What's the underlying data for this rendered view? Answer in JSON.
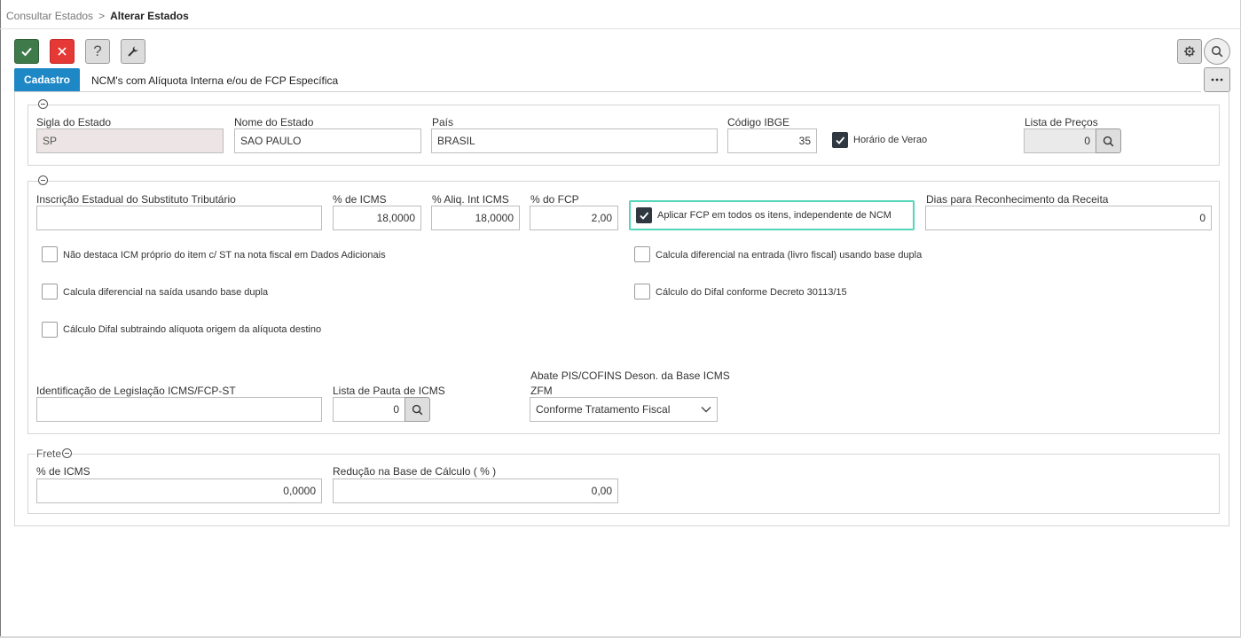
{
  "breadcrumb": {
    "parent": "Consultar Estados",
    "separator": ">",
    "current": "Alterar Estados"
  },
  "toolbar": {
    "help_label": "?"
  },
  "tabs": [
    {
      "label": "Cadastro",
      "active": true
    },
    {
      "label": "NCM's com Alíquota Interna e/ou de FCP Específica",
      "active": false
    }
  ],
  "section1": {
    "sigla": {
      "label": "Sigla do Estado",
      "value": "SP"
    },
    "nome": {
      "label": "Nome do Estado",
      "value": "SAO PAULO"
    },
    "pais": {
      "label": "País",
      "value": "BRASIL"
    },
    "ibge": {
      "label": "Código IBGE",
      "value": "35"
    },
    "horario_verao": {
      "label": "Horário de Verao",
      "checked": true
    },
    "lista_precos": {
      "label": "Lista de Preços",
      "value": "0"
    }
  },
  "section2": {
    "inscricao": {
      "label": "Inscrição Estadual do Substituto Tributário",
      "value": ""
    },
    "icms": {
      "label": "% de ICMS",
      "value": "18,0000"
    },
    "aliq_int": {
      "label": "% Aliq. Int ICMS",
      "value": "18,0000"
    },
    "fcp": {
      "label": "% do FCP",
      "value": "2,00"
    },
    "aplicar_fcp": {
      "label": "Aplicar FCP em todos os itens, independente de NCM",
      "checked": true
    },
    "dias_receita": {
      "label": "Dias para Reconhecimento da Receita",
      "value": "0"
    },
    "checkboxes": {
      "nao_destaca": {
        "label": "Não destaca ICM próprio do item c/ ST na nota fiscal em Dados Adicionais",
        "checked": false
      },
      "calc_entrada": {
        "label": "Calcula diferencial na entrada (livro fiscal) usando base dupla",
        "checked": false
      },
      "calc_saida": {
        "label": "Calcula diferencial na saída usando base dupla",
        "checked": false
      },
      "difal_decreto": {
        "label": "Cálculo do Difal conforme Decreto 30113/15",
        "checked": false
      },
      "difal_subtraindo": {
        "label": "Cálculo Difal subtraindo alíquota origem da alíquota destino",
        "checked": false
      }
    },
    "legislacao": {
      "label": "Identificação de Legislação ICMS/FCP-ST",
      "value": ""
    },
    "pauta": {
      "label": "Lista de Pauta de ICMS",
      "value": "0"
    },
    "abate": {
      "label_line1": "Abate PIS/COFINS Deson. da Base ICMS",
      "label_line2": "ZFM",
      "value": "Conforme Tratamento Fiscal"
    }
  },
  "section3": {
    "title": "Frete",
    "icms": {
      "label": "% de ICMS",
      "value": "0,0000"
    },
    "reducao": {
      "label": "Redução na Base de Cálculo ( % )",
      "value": "0,00"
    }
  },
  "colors": {
    "ok": "#3e7a4a",
    "cancel": "#e53935",
    "tab_active": "#1e88c7",
    "highlight": "#55d6b8",
    "checked": "#2f3740"
  }
}
